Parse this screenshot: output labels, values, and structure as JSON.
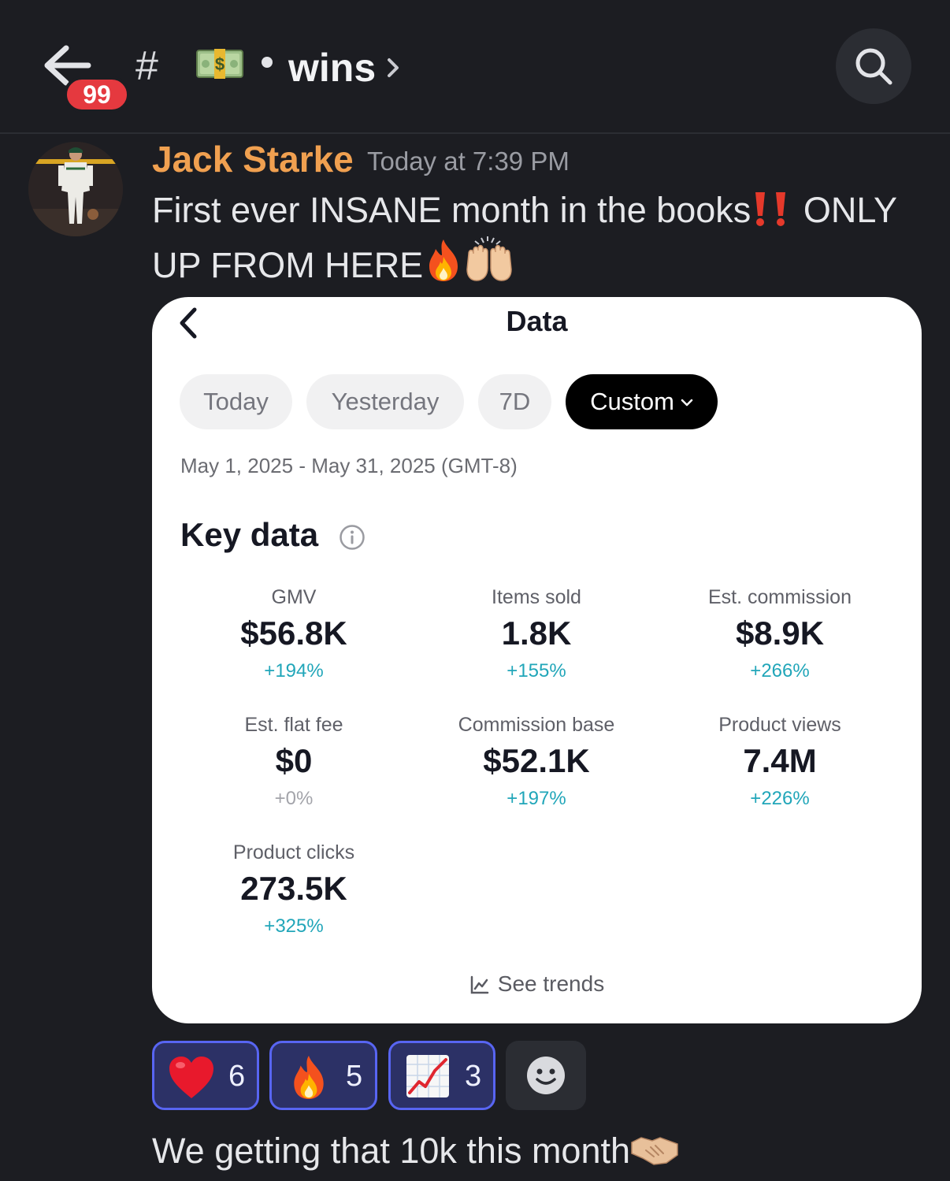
{
  "header": {
    "unread_count": "99",
    "hash": "#",
    "channel_name": "wins",
    "channel_icon": "money-bag-emoji"
  },
  "message": {
    "author": "Jack Starke",
    "author_color": "#f0a050",
    "timestamp": "Today at 7:39 PM",
    "text_part1": "First ever INSANE month in the books",
    "text_part2": " ONLY UP FROM HERE"
  },
  "card": {
    "title": "Data",
    "tabs": [
      {
        "label": "Today",
        "active": false
      },
      {
        "label": "Yesterday",
        "active": false
      },
      {
        "label": "7D",
        "active": false
      },
      {
        "label": "Custom",
        "active": true
      }
    ],
    "date_range": "May 1, 2025 - May 31, 2025 (GMT-8)",
    "section_title": "Key data",
    "metrics": [
      {
        "label": "GMV",
        "value": "$56.8K",
        "change": "+194%"
      },
      {
        "label": "Items sold",
        "value": "1.8K",
        "change": "+155%"
      },
      {
        "label": "Est. commission",
        "value": "$8.9K",
        "change": "+266%"
      },
      {
        "label": "Est. flat fee",
        "value": "$0",
        "change": "+0%"
      },
      {
        "label": "Commission base",
        "value": "$52.1K",
        "change": "+197%"
      },
      {
        "label": "Product views",
        "value": "7.4M",
        "change": "+226%"
      },
      {
        "label": "Product clicks",
        "value": "273.5K",
        "change": "+325%"
      }
    ],
    "trends_label": "See trends",
    "accent_color": "#21a6b9"
  },
  "reactions": [
    {
      "emoji": "red-heart",
      "count": "6"
    },
    {
      "emoji": "fire",
      "count": "5"
    },
    {
      "emoji": "chart-increasing",
      "count": "3"
    }
  ],
  "next_message": {
    "text": "We getting that 10k this month"
  }
}
